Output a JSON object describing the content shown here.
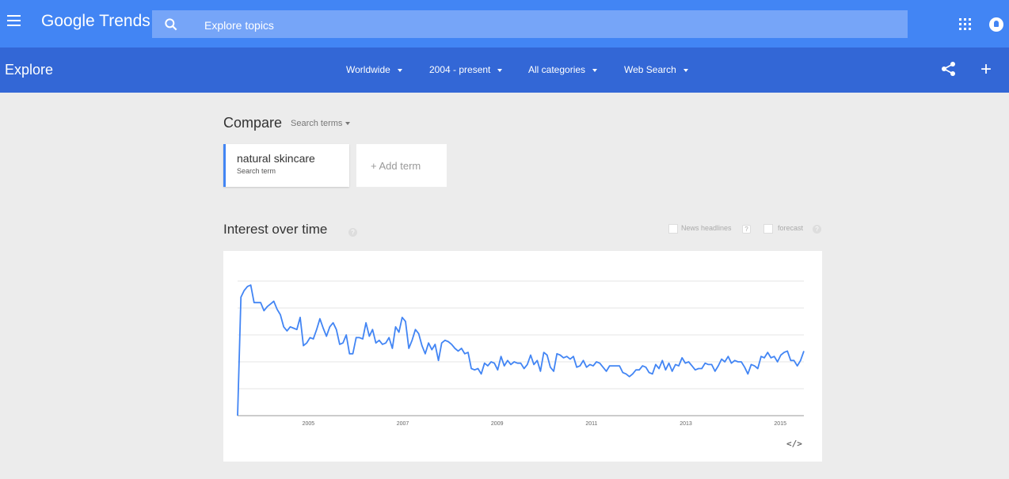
{
  "topbar": {
    "logo": "Google Trends",
    "search_placeholder": "Explore topics",
    "bg_color": "#4285f4"
  },
  "subbar": {
    "title": "Explore",
    "filters": {
      "region": "Worldwide",
      "time": "2004 - present",
      "category": "All categories",
      "property": "Web Search"
    },
    "bg_color": "#3367d6"
  },
  "compare": {
    "label": "Compare",
    "type_label": "Search terms",
    "term": {
      "name": "natural skincare",
      "subtitle": "Search term",
      "color": "#4285f4"
    },
    "add_term_label": "+ Add term"
  },
  "interest": {
    "title": "Interest over time",
    "help": "?",
    "news_headlines_label": "News headlines",
    "forecast_label": "forecast"
  },
  "chart_data": {
    "type": "line",
    "series": [
      {
        "name": "natural skincare",
        "color": "#4285f4",
        "values": [
          0,
          88,
          93,
          96,
          97,
          84,
          84,
          84,
          78,
          81,
          83,
          85,
          79,
          75,
          66,
          63,
          66,
          65,
          64,
          73,
          52,
          54,
          58,
          57,
          64,
          72,
          65,
          59,
          66,
          69,
          64,
          53,
          54,
          60,
          46,
          46,
          58,
          58,
          57,
          69,
          59,
          64,
          54,
          56,
          53,
          54,
          58,
          50,
          66,
          62,
          73,
          70,
          50,
          56,
          64,
          61,
          52,
          46,
          54,
          49,
          53,
          41,
          54,
          56,
          55,
          53,
          50,
          48,
          50,
          46,
          47,
          35,
          34,
          35,
          31,
          39,
          37,
          40,
          39,
          34,
          44,
          37,
          41,
          38,
          40,
          39,
          39,
          35,
          38,
          45,
          38,
          41,
          33,
          47,
          45,
          36,
          33,
          46,
          45,
          43,
          44,
          42,
          44,
          36,
          37,
          41,
          36,
          38,
          37,
          40,
          39,
          36,
          33,
          37,
          37,
          37,
          37,
          32,
          31,
          29,
          31,
          34,
          34,
          37,
          36,
          32,
          31,
          38,
          35,
          41,
          34,
          39,
          33,
          38,
          37,
          43,
          39,
          40,
          37,
          34,
          35,
          35,
          39,
          38,
          38,
          33,
          37,
          42,
          40,
          44,
          39,
          41,
          40,
          40,
          36,
          31,
          38,
          37,
          35,
          44,
          43,
          47,
          43,
          44,
          40,
          45,
          47,
          48,
          41,
          41,
          37,
          41,
          48
        ]
      }
    ],
    "x_ticks": [
      "2005",
      "2007",
      "2009",
      "2011",
      "2013",
      "2015"
    ],
    "x_tick_positions": [
      2005,
      2007,
      2009,
      2011,
      2013,
      2015
    ],
    "x_range": [
      2004,
      2016
    ],
    "ylim": [
      0,
      100
    ],
    "grid": true,
    "embed_label": "</>"
  }
}
